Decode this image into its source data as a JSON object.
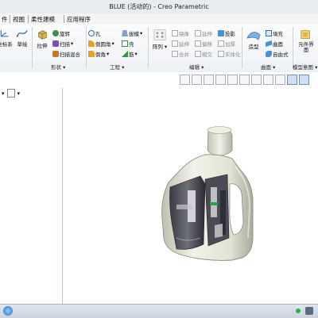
{
  "window": {
    "title": "BLUE (活动的) - Creo Parametric"
  },
  "tabs": [
    {
      "label": "件"
    },
    {
      "label": "视图"
    },
    {
      "label": "柔性建模"
    },
    {
      "label": "应用程序"
    }
  ],
  "ribbon": {
    "sketch_label": "草绘",
    "coordsys_label": "坐标系",
    "extrude_label": "拉伸",
    "shape_cmds": [
      "旋转",
      "扫描",
      "扫描混合"
    ],
    "hole_cmds": [
      "孔",
      "倒圆角",
      "倒角"
    ],
    "draft_cmds": [
      "拔模",
      "壳",
      "筋"
    ],
    "pattern_label": "阵列",
    "edit_cmds_col1": [
      "镜像",
      "延伸",
      "合并"
    ],
    "edit_cmds_col2": [
      "延伸",
      "偏移",
      "相交"
    ],
    "edit_cmds_col3": [
      "投影",
      "加厚",
      "实体化"
    ],
    "style_label": "造型",
    "surface_cmds": [
      "填充",
      "曲面",
      "自由式"
    ],
    "element_label": "元件界面",
    "groups": {
      "shape": "形状",
      "engineering": "工程",
      "edit": "编辑",
      "surface": "曲面",
      "model_intent": "模型意图"
    },
    "arrow": "▾"
  },
  "icons": {
    "view_toolbar": [
      "zoom-fit-icon",
      "zoom-in-icon",
      "zoom-out-icon",
      "repaint-icon",
      "orient-icon",
      "saved-views-icon",
      "display-style-icon",
      "datum-display-icon",
      "annotation-display-icon",
      "spin-center-icon"
    ],
    "colors": {
      "accent": "#2f6db5",
      "bottle": "#e7e7da",
      "label_dark": "#2a2a33"
    }
  }
}
